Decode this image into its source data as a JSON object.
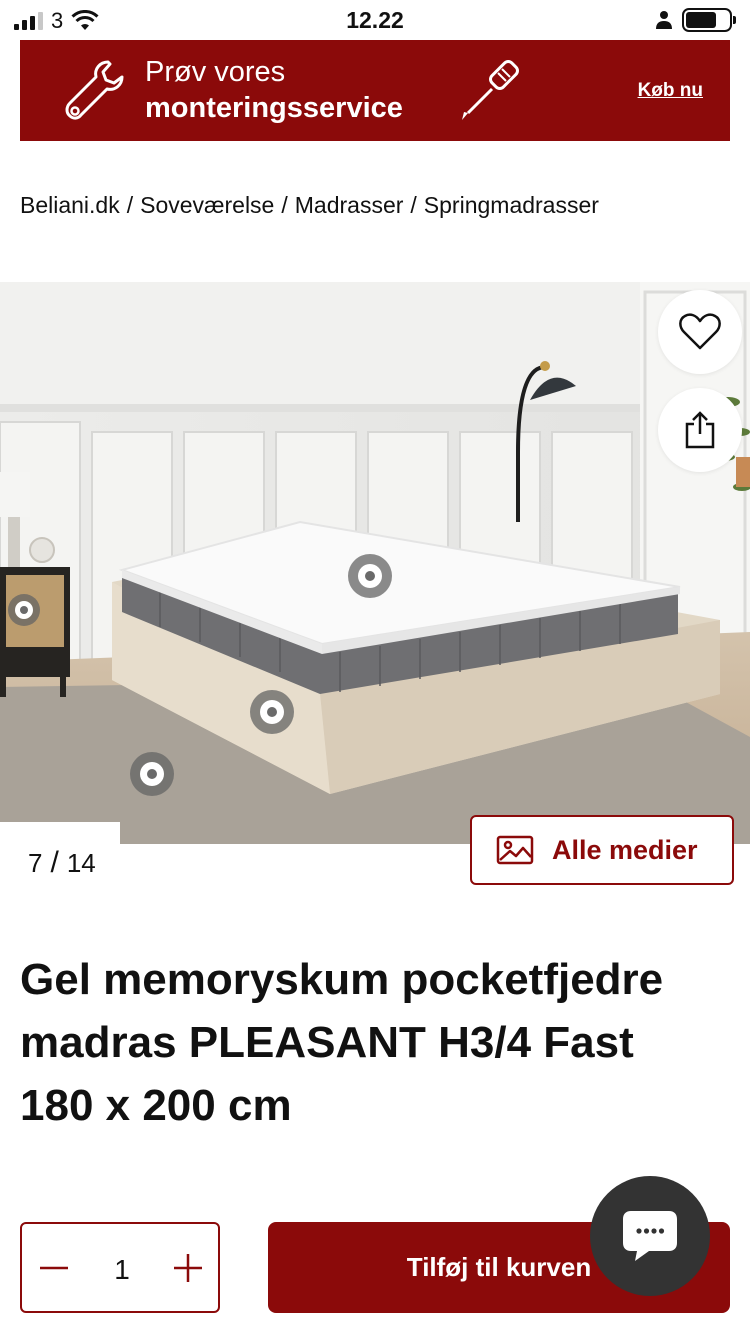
{
  "status_bar": {
    "carrier": "3",
    "time": "12.22"
  },
  "banner": {
    "line1": "Prøv vores",
    "line2": "monteringsservice",
    "link": "Køb nu",
    "background": "#8b0a0a"
  },
  "breadcrumb": {
    "items": [
      "Beliani.dk",
      "Soveværelse",
      "Madrasser",
      "Springmadrasser"
    ],
    "separator": "/"
  },
  "gallery": {
    "current": "7",
    "separator": "/",
    "total": "14",
    "all_media_label": "Alle medier"
  },
  "product": {
    "title": "Gel memoryskum pocketfjedre madras PLEASANT H3/4 Fast 180 x 200 cm",
    "quantity": "1",
    "add_to_cart_label": "Tilføj til kurven"
  },
  "icons": {
    "wishlist": "heart-icon",
    "share": "share-icon",
    "media": "image-icon",
    "chat": "chat-icon"
  },
  "colors": {
    "accent": "#8b0a0a",
    "chat": "#333333"
  }
}
